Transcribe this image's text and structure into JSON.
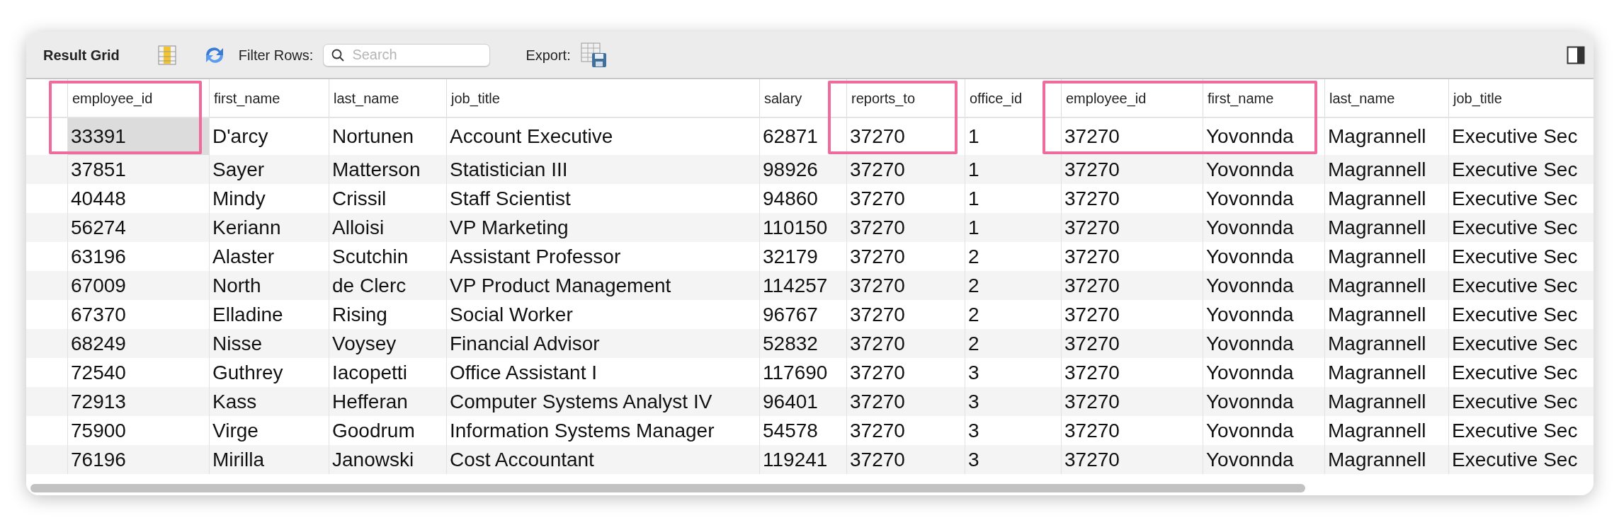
{
  "toolbar": {
    "title": "Result Grid",
    "filter_label": "Filter Rows:",
    "search": {
      "placeholder": "Search"
    },
    "export_label": "Export:"
  },
  "columns": [
    {
      "label": "employee_id",
      "highlighted": true
    },
    {
      "label": "first_name",
      "highlighted": false
    },
    {
      "label": "last_name",
      "highlighted": false
    },
    {
      "label": "job_title",
      "highlighted": false
    },
    {
      "label": "salary",
      "highlighted": false
    },
    {
      "label": "reports_to",
      "highlighted": true
    },
    {
      "label": "office_id",
      "highlighted": false
    },
    {
      "label": "employee_id",
      "highlighted": true
    },
    {
      "label": "first_name",
      "highlighted": true
    },
    {
      "label": "last_name",
      "highlighted": false
    },
    {
      "label": "job_title",
      "highlighted": false
    }
  ],
  "rows": [
    {
      "selected": true,
      "cells": [
        "33391",
        "D'arcy",
        "Nortunen",
        "Account Executive",
        "62871",
        "37270",
        "1",
        "37270",
        "Yovonnda",
        "Magrannell",
        "Executive Sec"
      ]
    },
    {
      "selected": false,
      "cells": [
        "37851",
        "Sayer",
        "Matterson",
        "Statistician III",
        "98926",
        "37270",
        "1",
        "37270",
        "Yovonnda",
        "Magrannell",
        "Executive Sec"
      ]
    },
    {
      "selected": false,
      "cells": [
        "40448",
        "Mindy",
        "Crissil",
        "Staff Scientist",
        "94860",
        "37270",
        "1",
        "37270",
        "Yovonnda",
        "Magrannell",
        "Executive Sec"
      ]
    },
    {
      "selected": false,
      "cells": [
        "56274",
        "Keriann",
        "Alloisi",
        "VP Marketing",
        "110150",
        "37270",
        "1",
        "37270",
        "Yovonnda",
        "Magrannell",
        "Executive Sec"
      ]
    },
    {
      "selected": false,
      "cells": [
        "63196",
        "Alaster",
        "Scutchin",
        "Assistant Professor",
        "32179",
        "37270",
        "2",
        "37270",
        "Yovonnda",
        "Magrannell",
        "Executive Sec"
      ]
    },
    {
      "selected": false,
      "cells": [
        "67009",
        "North",
        "de Clerc",
        "VP Product Management",
        "114257",
        "37270",
        "2",
        "37270",
        "Yovonnda",
        "Magrannell",
        "Executive Sec"
      ]
    },
    {
      "selected": false,
      "cells": [
        "67370",
        "Elladine",
        "Rising",
        "Social Worker",
        "96767",
        "37270",
        "2",
        "37270",
        "Yovonnda",
        "Magrannell",
        "Executive Sec"
      ]
    },
    {
      "selected": false,
      "cells": [
        "68249",
        "Nisse",
        "Voysey",
        "Financial Advisor",
        "52832",
        "37270",
        "2",
        "37270",
        "Yovonnda",
        "Magrannell",
        "Executive Sec"
      ]
    },
    {
      "selected": false,
      "cells": [
        "72540",
        "Guthrey",
        "Iacopetti",
        "Office Assistant I",
        "117690",
        "37270",
        "3",
        "37270",
        "Yovonnda",
        "Magrannell",
        "Executive Sec"
      ]
    },
    {
      "selected": false,
      "cells": [
        "72913",
        "Kass",
        "Hefferan",
        "Computer Systems Analyst IV",
        "96401",
        "37270",
        "3",
        "37270",
        "Yovonnda",
        "Magrannell",
        "Executive Sec"
      ]
    },
    {
      "selected": false,
      "cells": [
        "75900",
        "Virge",
        "Goodrum",
        "Information Systems Manager",
        "54578",
        "37270",
        "3",
        "37270",
        "Yovonnda",
        "Magrannell",
        "Executive Sec"
      ]
    },
    {
      "selected": false,
      "cells": [
        "76196",
        "Mirilla",
        "Janowski",
        "Cost Accountant",
        "119241",
        "37270",
        "3",
        "37270",
        "Yovonnda",
        "Magrannell",
        "Executive Sec"
      ]
    }
  ]
}
